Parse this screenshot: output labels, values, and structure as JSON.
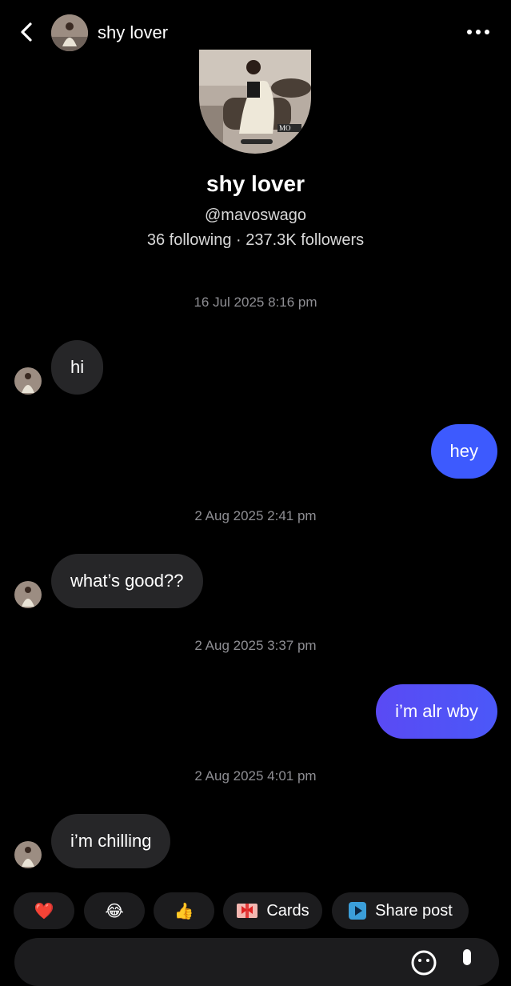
{
  "header": {
    "title": "shy lover"
  },
  "profile": {
    "name": "shy lover",
    "handle": "@mavoswago",
    "stats": "36 following · 237.3K followers"
  },
  "messages": [
    {
      "timestamp": "16 Jul 2025 8:16 pm"
    },
    {
      "from": "them",
      "text": "hi"
    },
    {
      "from": "me",
      "text": "hey"
    },
    {
      "timestamp": "2 Aug 2025 2:41 pm"
    },
    {
      "from": "them",
      "text": "what’s good??"
    },
    {
      "timestamp": "2 Aug 2025 3:37 pm"
    },
    {
      "from": "me",
      "text": "i’m alr wby"
    },
    {
      "timestamp": "2 Aug 2025 4:01 pm"
    },
    {
      "from": "them",
      "text": "i’m chilling"
    }
  ],
  "quick_actions": {
    "heart": "❤️",
    "laugh": "😂",
    "thumbs": "👍",
    "cards_label": "Cards",
    "share_label": "Share post"
  },
  "colors": {
    "background": "#000000",
    "incoming_bubble": "#262628",
    "outgoing_blue": "#3D5AFE",
    "outgoing_purple": "#5B4BF5",
    "timestamp": "#8E8E93"
  }
}
